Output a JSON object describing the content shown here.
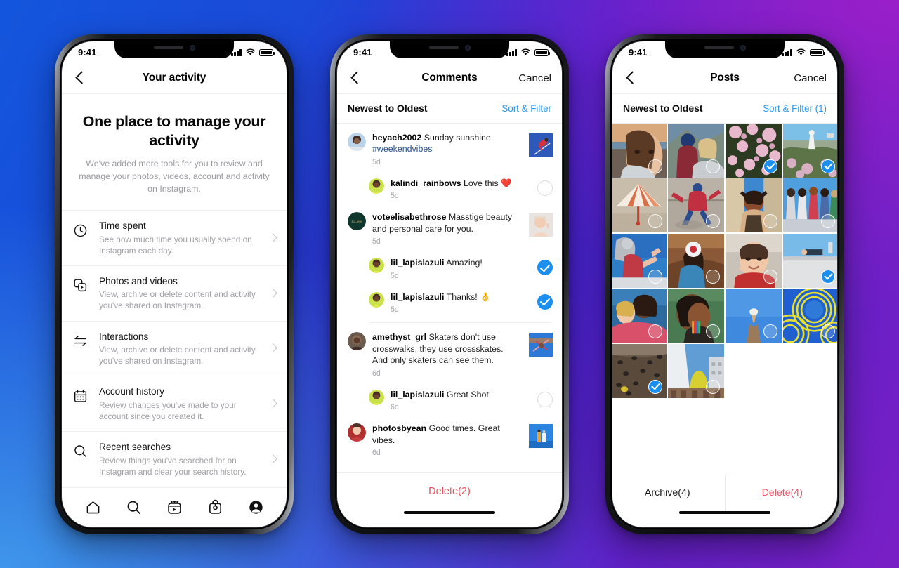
{
  "background": {
    "gradient_from": "#1356dd",
    "gradient_mid": "#3a23cf",
    "gradient_to": "#9a1fc9",
    "accent_blue": "#3f96ea",
    "accent_purple": "#7a1fc6"
  },
  "colors": {
    "link_blue": "#2d97f0",
    "select_blue": "#1b8ff0",
    "delete_red": "#ec4d5c",
    "text_primary": "#111111",
    "text_secondary": "#a0a0a5"
  },
  "status_bar": {
    "time": "9:41",
    "signal_icon": "cellular-bars-icon",
    "wifi_icon": "wifi-icon",
    "battery_icon": "battery-full-icon"
  },
  "phone1": {
    "nav": {
      "back_icon": "chevron-left-icon",
      "title": "Your activity"
    },
    "hero": {
      "heading": "One place to manage your activity",
      "subheading": "We've added more tools for you to review and manage your photos, videos, account and activity on Instagram."
    },
    "items": [
      {
        "icon": "clock-icon",
        "title": "Time spent",
        "desc": "See how much time you usually spend on Instagram each day.",
        "chevron": "chevron-right-icon"
      },
      {
        "icon": "photos-videos-icon",
        "title": "Photos and videos",
        "desc": "View, archive or delete content and activity you've shared on Instagram.",
        "chevron": "chevron-right-icon"
      },
      {
        "icon": "interactions-arrows-icon",
        "title": "Interactions",
        "desc": "View, archive or delete content and activity you've shared on Instagram.",
        "chevron": "chevron-right-icon"
      },
      {
        "icon": "calendar-icon",
        "title": "Account history",
        "desc": "Review changes you've made to your account since you created it.",
        "chevron": "chevron-right-icon"
      },
      {
        "icon": "search-icon",
        "title": "Recent searches",
        "desc": "Review things you've searched for on Instagram and clear your search history.",
        "chevron": "chevron-right-icon"
      }
    ],
    "tabbar": [
      {
        "icon": "home-icon",
        "label": "Home"
      },
      {
        "icon": "search-icon",
        "label": "Search"
      },
      {
        "icon": "reels-icon",
        "label": "Reels"
      },
      {
        "icon": "shop-bag-icon",
        "label": "Shop"
      },
      {
        "icon": "profile-avatar-icon",
        "label": "Profile"
      }
    ]
  },
  "phone2": {
    "nav": {
      "back_icon": "chevron-left-icon",
      "title": "Comments",
      "right_label": "Cancel"
    },
    "sort": {
      "label": "Newest to Oldest",
      "action": "Sort & Filter"
    },
    "comments": [
      {
        "user": "heyach2002",
        "text": "Sunday sunshine.",
        "tag": "#weekendvibes",
        "time": "5d",
        "reply": false,
        "trailing": "thumbnail",
        "thumb": "ski-jumper-blue"
      },
      {
        "user": "kalindi_rainbows",
        "text": "Love this ❤️",
        "tag": "",
        "time": "5d",
        "reply": true,
        "trailing": "circle",
        "thumb": ""
      },
      {
        "user": "voteelisabethrose",
        "text": "Masstige beauty and personal care for you.",
        "tag": "",
        "time": "5d",
        "reply": false,
        "trailing": "thumbnail",
        "thumb": "smiling-woman"
      },
      {
        "user": "lil_lapislazuli",
        "text": "Amazing!",
        "tag": "",
        "time": "5d",
        "reply": true,
        "trailing": "check",
        "thumb": ""
      },
      {
        "user": "lil_lapislazuli",
        "text": "Thanks! 👌",
        "tag": "",
        "time": "5d",
        "reply": true,
        "trailing": "check",
        "thumb": ""
      },
      {
        "user": "amethyst_grl",
        "text": "Skaters don't use crosswalks, they use crossskates. And only skaters can see them.",
        "tag": "",
        "time": "6d",
        "reply": false,
        "trailing": "thumbnail",
        "thumb": "skater-sky"
      },
      {
        "user": "lil_lapislazuli",
        "text": "Great Shot!",
        "tag": "",
        "time": "6d",
        "reply": true,
        "trailing": "circle",
        "thumb": ""
      },
      {
        "user": "photosbyean",
        "text": "Good times. Great vibes.",
        "tag": "",
        "time": "6d",
        "reply": false,
        "trailing": "thumbnail",
        "thumb": "two-people-sky"
      }
    ],
    "footer": {
      "delete_label": "Delete(2)"
    }
  },
  "phone3": {
    "nav": {
      "back_icon": "chevron-left-icon",
      "title": "Posts",
      "right_label": "Cancel"
    },
    "sort": {
      "label": "Newest to Oldest",
      "action": "Sort & Filter (1)"
    },
    "grid": {
      "columns": 4,
      "selected_count": 4,
      "cells": [
        {
          "id": 1,
          "art": "portrait-sunset",
          "selected": false
        },
        {
          "id": 2,
          "art": "friends-mountain",
          "selected": false
        },
        {
          "id": 3,
          "art": "pink-blossoms",
          "selected": true
        },
        {
          "id": 4,
          "art": "hillside-statue",
          "selected": true
        },
        {
          "id": 5,
          "art": "striped-umbrella",
          "selected": false
        },
        {
          "id": 6,
          "art": "jumping-skater",
          "selected": false
        },
        {
          "id": 7,
          "art": "woman-arms-up",
          "selected": false
        },
        {
          "id": 8,
          "art": "group-wall-sky",
          "selected": false
        },
        {
          "id": 9,
          "art": "statue-climb-sky",
          "selected": false
        },
        {
          "id": 10,
          "art": "balloon-cliff",
          "selected": false
        },
        {
          "id": 11,
          "art": "smiling-portrait",
          "selected": false
        },
        {
          "id": 12,
          "art": "rooftop-lounger",
          "selected": true
        },
        {
          "id": 13,
          "art": "couple-embrace",
          "selected": false
        },
        {
          "id": 14,
          "art": "earring-profile",
          "selected": false
        },
        {
          "id": 15,
          "art": "icecream-sky",
          "selected": false
        },
        {
          "id": 16,
          "art": "yellow-spiral",
          "selected": false
        },
        {
          "id": 17,
          "art": "climbing-wall",
          "selected": true
        },
        {
          "id": 18,
          "art": "yellow-statue-city",
          "selected": false
        }
      ]
    },
    "footer": {
      "archive_label": "Archive(4)",
      "delete_label": "Delete(4)"
    }
  }
}
